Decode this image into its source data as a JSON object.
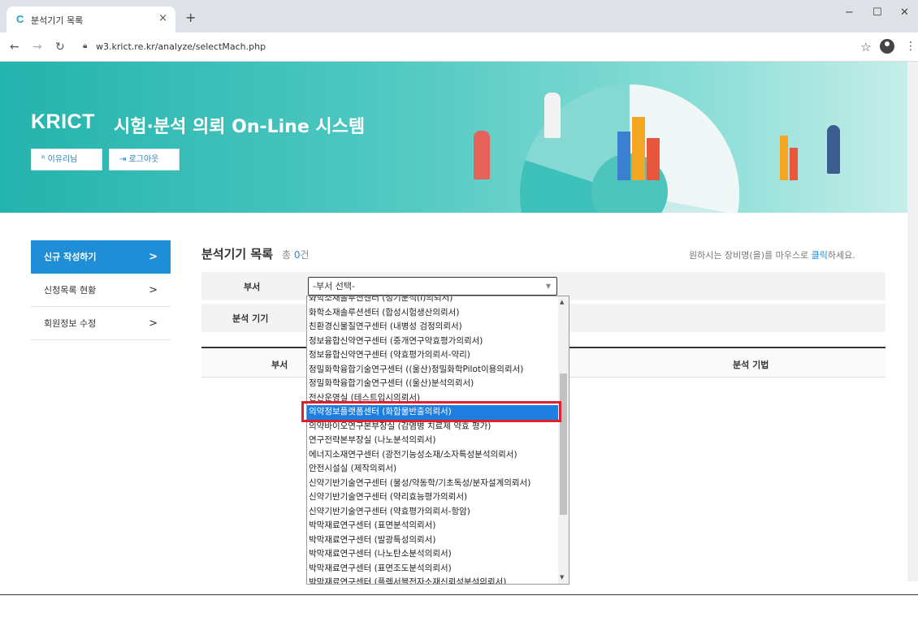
{
  "browser": {
    "tab_title": "분석기기 목록",
    "tab_close": "×",
    "new_tab": "+",
    "url": "w3.krict.re.kr/analyze/selectMach.php"
  },
  "banner": {
    "brand": "KRICT",
    "subtitle": "시험·분석 의뢰 On-Line 시스템",
    "user_button": "이유리님",
    "logout_button": "로그아웃"
  },
  "sidebar": {
    "items": [
      {
        "label": "신규 작성하기",
        "arrow": ">"
      },
      {
        "label": "신청목록 현황",
        "arrow": ">"
      },
      {
        "label": "회원정보 수정",
        "arrow": ">"
      }
    ]
  },
  "main": {
    "title": "분석기기 목록",
    "count_prefix": "총",
    "count": "0",
    "count_suffix": "건",
    "hint_pre": "원하시는 장비명(을)를 마우스로",
    "hint_click": "클릭",
    "hint_post": "하세요.",
    "label_dept": "부서",
    "label_equip": "분석 기기",
    "select_value": "-부서 선택-",
    "col_dept": "부서",
    "col_method": "분석 기법"
  },
  "dropdown": {
    "items": [
      "화학소재솔루션센터 (정기분석(I)의뢰서)",
      "화학소재솔루션센터 (합성시험생산의뢰서)",
      "친환경신물질연구센터 (내병성 검정의뢰서)",
      "정보융합신약연구센터 (중개연구약효평가의뢰서)",
      "정보융합신약연구센터 (약효평가의뢰서-약리)",
      "정밀화학융합기술연구센터 ((울산)정밀화학Pilot이용의뢰서)",
      "정밀화학융합기술연구센터 ((울산)분석의뢰서)",
      "전산운영실 (테스트입시의뢰서)",
      "의약정보플랫폼센터 (화합물반출의뢰서)",
      "의약바이오연구본부장실 (감염병 치료제 약효 평가)",
      "연구전략본부장실 (나노분석의뢰서)",
      "에너지소재연구센터 (광전기능성소재/소자특성분석의뢰서)",
      "안전시설실 (제작의뢰서)",
      "신약기반기술연구센터 (물성/약동학/기초독성/분자설계의뢰서)",
      "신약기반기술연구센터 (약리효능평가의뢰서)",
      "신약기반기술연구센터 (약효평가의뢰서-항암)",
      "박막재료연구센터 (표면분석의뢰서)",
      "박막재료연구센터 (발광특성의뢰서)",
      "박막재료연구센터 (나노탄소분석의뢰서)",
      "박막재료연구센터 (표면조도분석의뢰서)",
      "박막재료연구센터 (플렉서블전자소재신뢰성분석의뢰서)"
    ],
    "selected_index": 8
  },
  "colors": {
    "accent": "#1f8ed6",
    "highlight": "#e0202a",
    "selected_bg": "#1e7fe0"
  }
}
